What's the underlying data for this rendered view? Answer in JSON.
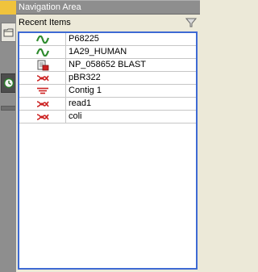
{
  "window": {
    "title": "Navigation Area"
  },
  "panel": {
    "header": "Recent Items"
  },
  "items": [
    {
      "name": "P68225",
      "icon": "protein-sequence-icon"
    },
    {
      "name": "1A29_HUMAN",
      "icon": "protein-sequence-icon"
    },
    {
      "name": "NP_058652 BLAST",
      "icon": "blast-result-icon"
    },
    {
      "name": "pBR322",
      "icon": "nucleotide-sequence-icon"
    },
    {
      "name": "Contig 1",
      "icon": "contig-icon"
    },
    {
      "name": "read1",
      "icon": "nucleotide-sequence-icon"
    },
    {
      "name": "coli",
      "icon": "nucleotide-sequence-icon"
    }
  ],
  "colors": {
    "accent": "#f0c33c",
    "selection_border": "#3e6ad4",
    "protein": "#2e8b2e",
    "nucleotide": "#cc2222"
  }
}
